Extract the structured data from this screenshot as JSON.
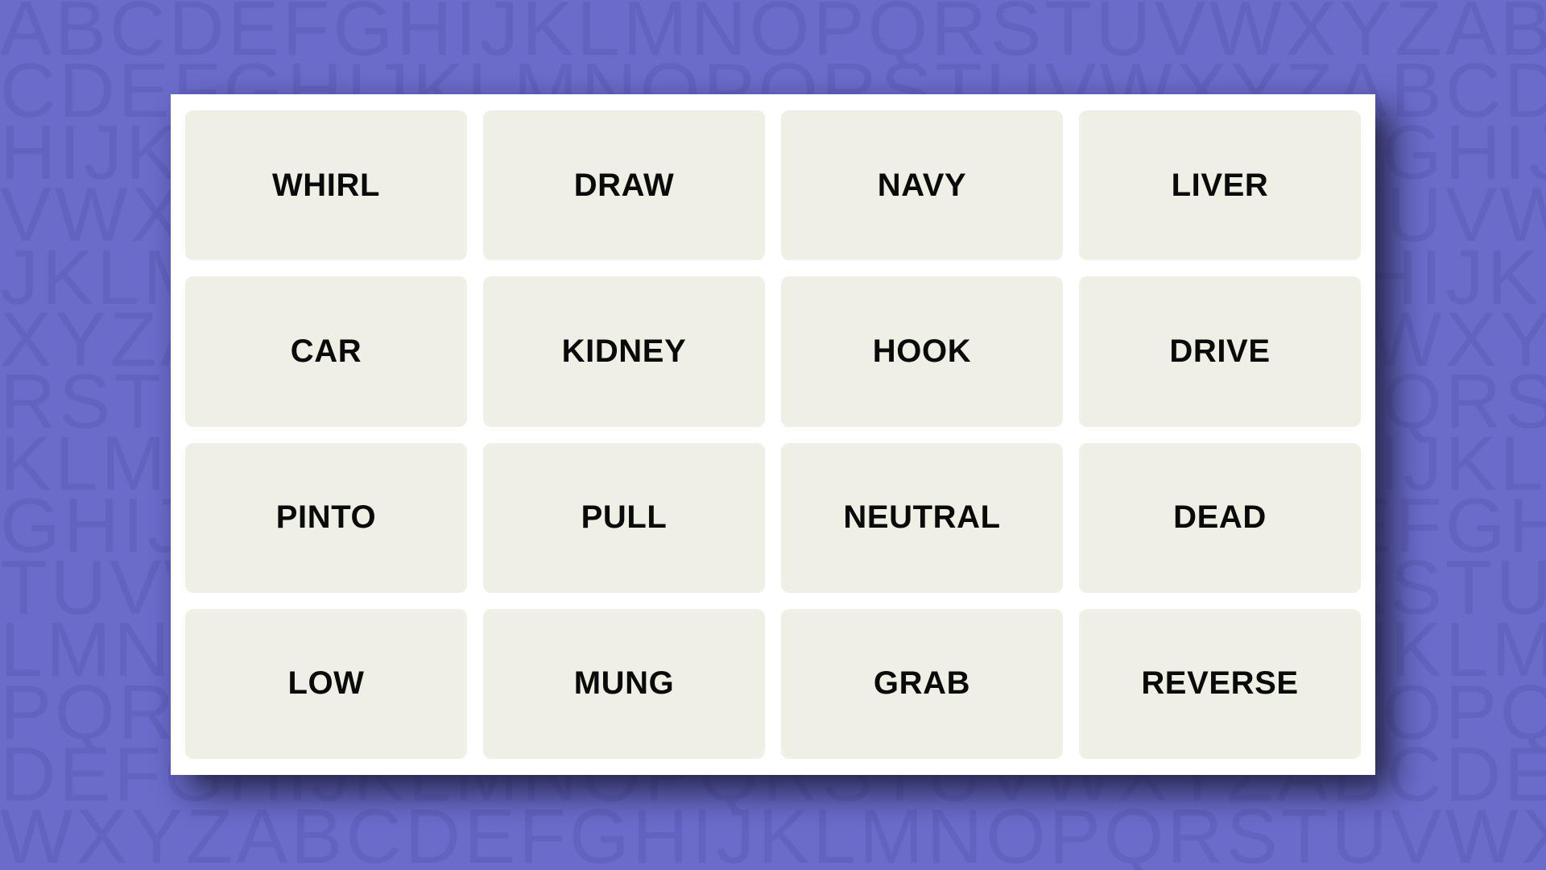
{
  "theme": {
    "background_color": "#6B6BCB",
    "wallpaper_letter_color": "#6262C0",
    "board_color": "#FFFFFF",
    "tile_color": "#EFEFE6",
    "tile_text_color": "#0A0A0A",
    "shadow_color": "#1C1C3C"
  },
  "wallpaper": {
    "rows": [
      "ABCDEFGHIJKLMNOPQRSTUVWXYZABCDEFGHIJ",
      "CDEFGHIJKLMNOPQRSTUVWXYZABCDEFGHIJKL",
      "HIJKLMNOPQRSTUVWXYZABCDEFGHIJKLMNOPQ",
      "VWXYZABCDEFGHIJKLMNOPQRSTUVWXYZABCDE",
      "JKLMNOPQRSTUVWXYZABCDEFGHIJKLMNOPQRS",
      "XYZABCDEFGHIJKLMNOPQRSTUVWXYZABCDEFG",
      "RSTUVWXYZABCDEFGHIJKLMNOPQRSTUVWXYZA",
      "KLMNOPQRSTUVWXYZABCDEFGHIJKLMNOPQRST",
      "GHIJKLMNOPQRSTUVWXYZABCDEFGHIJKLMNOP",
      "TUVWXYZABCDEFGHIJKLMNOPQRSTUVWXYZABC",
      "LMNOPQRSTUVWXYZABCDEFGHIJKLMNOPQRSTU",
      "PQRSTUVWXYZABCDEFGHIJKLMNOPQRSTUVWXY",
      "DEFGHIJKLMNOPQRSTUVWXYZABCDEFGHIJKLM",
      "WXYZABCDEFGHIJKLMNOPQRSTUVWXYZABCDEF"
    ]
  },
  "board": {
    "columns": 4,
    "rows": 4,
    "tiles": [
      {
        "label": "WHIRL",
        "row": 1,
        "col": 1
      },
      {
        "label": "DRAW",
        "row": 1,
        "col": 2
      },
      {
        "label": "NAVY",
        "row": 1,
        "col": 3
      },
      {
        "label": "LIVER",
        "row": 1,
        "col": 4
      },
      {
        "label": "CAR",
        "row": 2,
        "col": 1
      },
      {
        "label": "KIDNEY",
        "row": 2,
        "col": 2
      },
      {
        "label": "HOOK",
        "row": 2,
        "col": 3
      },
      {
        "label": "DRIVE",
        "row": 2,
        "col": 4
      },
      {
        "label": "PINTO",
        "row": 3,
        "col": 1
      },
      {
        "label": "PULL",
        "row": 3,
        "col": 2
      },
      {
        "label": "NEUTRAL",
        "row": 3,
        "col": 3
      },
      {
        "label": "DEAD",
        "row": 3,
        "col": 4
      },
      {
        "label": "LOW",
        "row": 4,
        "col": 1
      },
      {
        "label": "MUNG",
        "row": 4,
        "col": 2
      },
      {
        "label": "GRAB",
        "row": 4,
        "col": 3
      },
      {
        "label": "REVERSE",
        "row": 4,
        "col": 4
      }
    ]
  }
}
